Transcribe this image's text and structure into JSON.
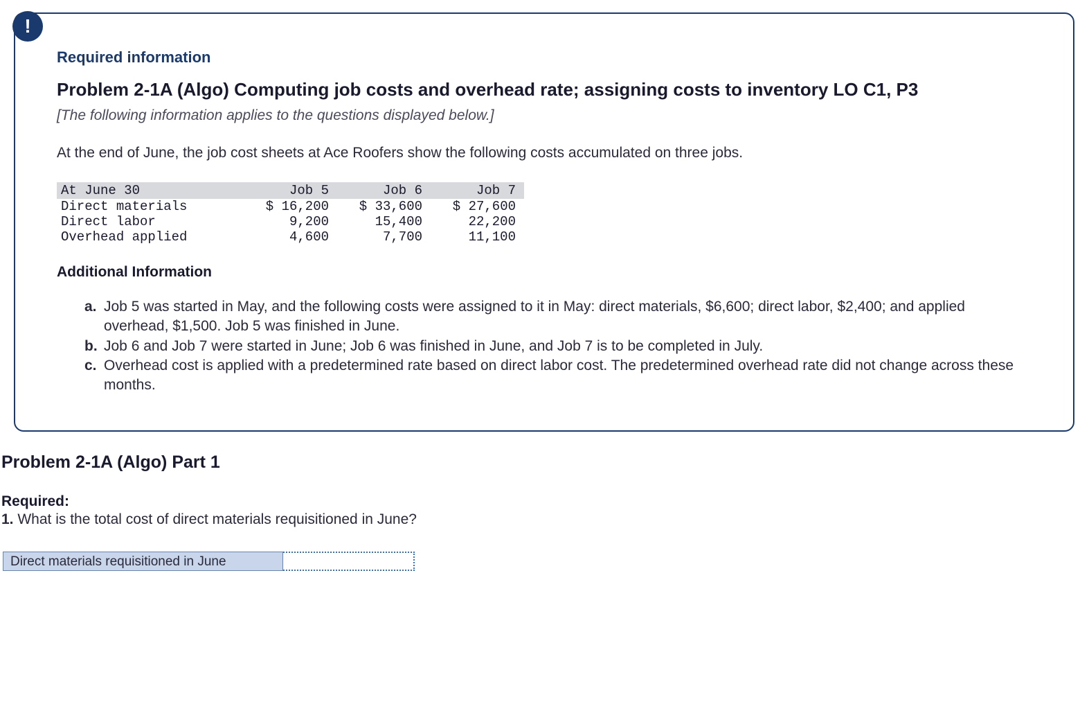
{
  "info_box": {
    "badge": "!",
    "required_heading": "Required information",
    "problem_title": "Problem 2-1A (Algo) Computing job costs and overhead rate; assigning costs to inventory LO C1, P3",
    "applies_note": "[The following information applies to the questions displayed below.]",
    "lead_para": "At the end of June, the job cost sheets at Ace Roofers show the following costs accumulated on three jobs.",
    "table": {
      "header_label": "At June 30",
      "col1": "Job 5",
      "col2": "Job 6",
      "col3": "Job 7",
      "rows": [
        {
          "label": "Direct materials",
          "v1": "$ 16,200",
          "v2": "$ 33,600",
          "v3": "$ 27,600"
        },
        {
          "label": "Direct labor",
          "v1": "9,200",
          "v2": "15,400",
          "v3": "22,200"
        },
        {
          "label": "Overhead applied",
          "v1": "4,600",
          "v2": "7,700",
          "v3": "11,100"
        }
      ]
    },
    "additional_heading": "Additional Information",
    "additional_items": [
      {
        "marker": "a.",
        "text": "Job 5 was started in May, and the following costs were assigned to it in May: direct materials, $6,600; direct labor, $2,400; and applied overhead, $1,500. Job 5 was finished in June."
      },
      {
        "marker": "b.",
        "text": "Job 6 and Job 7 were started in June; Job 6 was finished in June, and Job 7 is to be completed in July."
      },
      {
        "marker": "c.",
        "text": "Overhead cost is applied with a predetermined rate based on direct labor cost. The predetermined overhead rate did not change across these months."
      }
    ]
  },
  "part": {
    "title": "Problem 2-1A (Algo) Part 1",
    "required_label": "Required:",
    "question_num": "1.",
    "question_text": " What is the total cost of direct materials requisitioned in June?",
    "answer_label": "Direct materials requisitioned in June",
    "answer_value": ""
  }
}
